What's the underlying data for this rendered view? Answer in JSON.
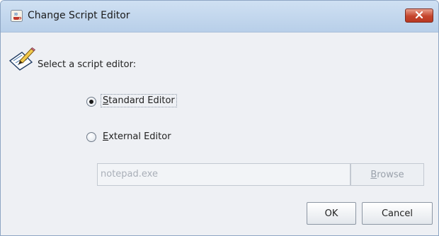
{
  "window": {
    "title": "Change Script Editor",
    "app_icon": "java-cup-icon",
    "close_icon": "close-icon",
    "close_color": "#c5452c"
  },
  "content": {
    "prompt_icon": "edit-pencil-icon",
    "prompt": "Select a script editor:",
    "options": [
      {
        "label": "Standard Editor",
        "mnemonic": "S",
        "rest": "tandard Editor",
        "selected": true
      },
      {
        "label": "External Editor",
        "mnemonic": "E",
        "rest": "xternal Editor",
        "selected": false
      }
    ],
    "editor_path": {
      "value": "notepad.exe",
      "enabled": false
    },
    "browse": {
      "mnemonic": "B",
      "rest": "rowse",
      "enabled": false
    }
  },
  "buttons": {
    "ok": "OK",
    "cancel": "Cancel"
  }
}
